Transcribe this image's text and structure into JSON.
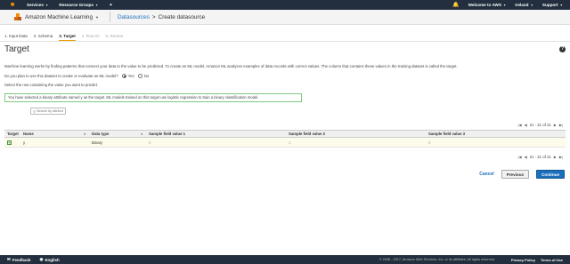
{
  "topbar": {
    "services": "Services",
    "resource_groups": "Resource Groups",
    "account": "Welcome to AWS",
    "region": "Ireland",
    "support": "Support"
  },
  "appbar": {
    "service_title": "Amazon Machine Learning",
    "breadcrumb_link": "Datasources",
    "breadcrumb_sep": ">",
    "breadcrumb_current": "Create datasource"
  },
  "steps": [
    {
      "label": "1. Input Data",
      "state": "done"
    },
    {
      "label": "2. Schema",
      "state": "done"
    },
    {
      "label": "3. Target",
      "state": "active"
    },
    {
      "label": "4. Row ID",
      "state": "disabled"
    },
    {
      "label": "5. Review",
      "state": "disabled"
    }
  ],
  "page": {
    "title": "Target",
    "description": "Machine learning works by finding patterns that connect your data to the value to be predicted. To create an ML model, Amazon ML analyzes examples of data records with correct values. The column that contains these values in the training dataset is called the target.",
    "question": "Do you plan to use this dataset to create or evaluate an ML model?",
    "yes_label": "Yes",
    "no_label": "No",
    "instruction": "Select the row containing the value you want to predict.",
    "alert": "You have selected a binary attribute named y as the target. ML models trained on this target use logistic regression to train a binary classification model."
  },
  "search": {
    "placeholder": "Search by attribute name"
  },
  "pager": {
    "range": "21 - 21 of 21"
  },
  "table": {
    "headers": {
      "target": "Target",
      "name": "Name",
      "data_type": "Data type",
      "sample1": "Sample field value 1",
      "sample2": "Sample field value 2",
      "sample3": "Sample field value 3"
    },
    "rows": [
      {
        "name": "y",
        "data_type": "Binary",
        "sample1": "0",
        "sample2": "1",
        "sample3": "0"
      }
    ]
  },
  "actions": {
    "cancel": "Cancel",
    "previous": "Previous",
    "continue": "Continue"
  },
  "footer": {
    "feedback": "Feedback",
    "language": "English",
    "copyright": "© 2008 - 2017, Amazon Web Services, Inc. or its affiliates. All rights reserved.",
    "privacy": "Privacy Policy",
    "terms": "Terms of Use"
  },
  "colors": {
    "nav_bg": "#232f3e",
    "accent_orange": "#ff9900",
    "link_blue": "#1f6ebc",
    "primary_button": "#1b6fbd",
    "alert_border": "#7ec87e",
    "selected_row": "#fdfbea"
  }
}
